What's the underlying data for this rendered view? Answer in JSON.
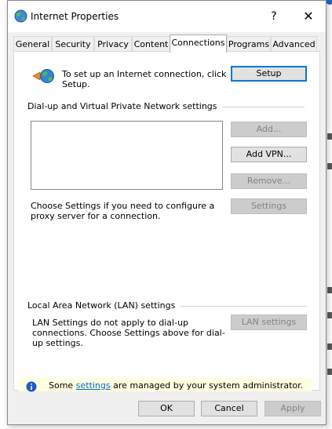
{
  "window": {
    "title": "Internet Properties",
    "help": "?",
    "close": "✕"
  },
  "tabs": [
    {
      "label": "General"
    },
    {
      "label": "Security"
    },
    {
      "label": "Privacy"
    },
    {
      "label": "Content"
    },
    {
      "label": "Connections",
      "selected": true
    },
    {
      "label": "Programs"
    },
    {
      "label": "Advanced"
    }
  ],
  "setup": {
    "text": "To set up an Internet connection, click Setup.",
    "button": "Setup"
  },
  "dialup": {
    "heading": "Dial-up and Virtual Private Network settings",
    "add_button": "Add...",
    "add_vpn_button": "Add VPN...",
    "remove_button": "Remove...",
    "settings_button": "Settings",
    "proxy_text": "Choose Settings if you need to configure a proxy server for a connection."
  },
  "lan": {
    "heading": "Local Area Network (LAN) settings",
    "text": "LAN Settings do not apply to dial-up connections. Choose Settings above for dial-up settings.",
    "button": "LAN settings"
  },
  "info": {
    "prefix": "Some",
    "link": "settings",
    "suffix": "are managed by your system administrator."
  },
  "footer": {
    "ok": "OK",
    "cancel": "Cancel",
    "apply": "Apply"
  },
  "colors": {
    "accent": "#0078d7",
    "info_bg": "#ffffe1",
    "disabled_text": "#838383"
  }
}
